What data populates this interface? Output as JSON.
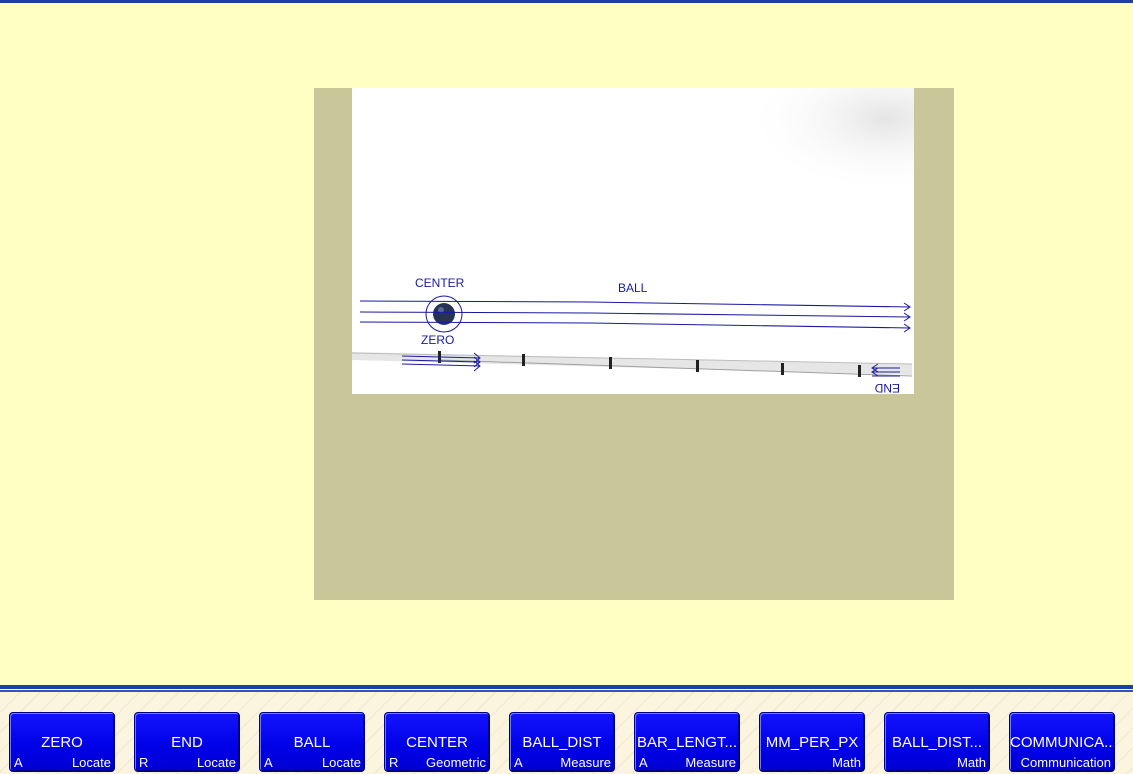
{
  "overlay": {
    "labels": {
      "center": "CENTER",
      "ball": "BALL",
      "zero": "ZERO",
      "end": "END"
    },
    "line_color": "#1a1aa0"
  },
  "toolbar": {
    "buttons": [
      {
        "name": "ZERO",
        "mode": "A",
        "type": "Locate"
      },
      {
        "name": "END",
        "mode": "R",
        "type": "Locate"
      },
      {
        "name": "BALL",
        "mode": "A",
        "type": "Locate"
      },
      {
        "name": "CENTER",
        "mode": "R",
        "type": "Geometric"
      },
      {
        "name": "BALL_DIST",
        "mode": "A",
        "type": "Measure"
      },
      {
        "name": "BAR_LENGT...",
        "mode": "A",
        "type": "Measure"
      },
      {
        "name": "MM_PER_PX",
        "mode": "",
        "type": "Math"
      },
      {
        "name": "BALL_DIST...",
        "mode": "",
        "type": "Math"
      },
      {
        "name": "COMMUNICA...",
        "mode": "",
        "type": "Communication"
      }
    ]
  },
  "colors": {
    "background": "#ffffc4",
    "viewport": "#c9c79a",
    "button": "#0000e6",
    "accent_rule": "#1c3fa8"
  }
}
